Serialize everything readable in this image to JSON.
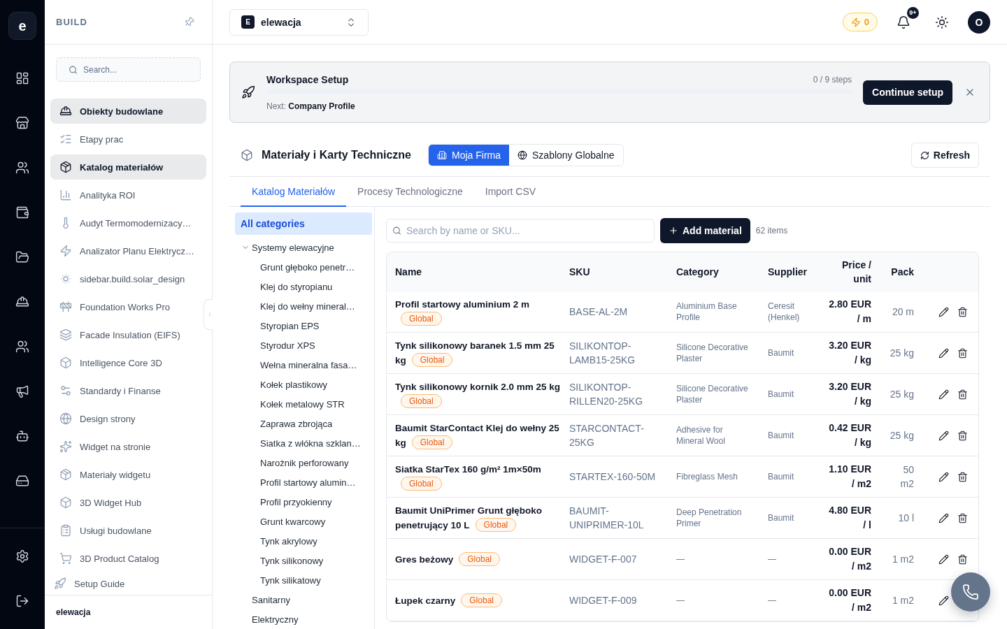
{
  "rail": {
    "logo": "e"
  },
  "sidebar": {
    "title": "BUILD",
    "search": {
      "placeholder": "Search..."
    },
    "items": [
      {
        "label": "Obiekty budowlane",
        "selected": true
      },
      {
        "label": "Etapy prac",
        "selected": false
      },
      {
        "label": "Katalog materiałów",
        "selected": true
      },
      {
        "label": "Analityka ROI",
        "selected": false
      },
      {
        "label": "Audyt Termomodernizacy…",
        "selected": false
      },
      {
        "label": "Analizator Planu Elektrycz…",
        "selected": false
      },
      {
        "label": "sidebar.build.solar_design",
        "selected": false
      },
      {
        "label": "Foundation Works Pro",
        "selected": false
      },
      {
        "label": "Facade Insulation (EIFS)",
        "selected": false
      },
      {
        "label": "Intelligence Core 3D",
        "selected": false
      },
      {
        "label": "Standardy i Finanse",
        "selected": false
      },
      {
        "label": "Design strony",
        "selected": false
      },
      {
        "label": "Widget na stronie",
        "selected": false
      },
      {
        "label": "Materiały widgetu",
        "selected": false
      },
      {
        "label": "3D Widget Hub",
        "selected": false
      },
      {
        "label": "Usługi budowlane",
        "selected": false
      },
      {
        "label": "3D Product Catalog",
        "selected": false
      }
    ],
    "setup_guide": "Setup Guide",
    "footer": "elewacja"
  },
  "topbar": {
    "workspace": {
      "initial": "E",
      "name": "elewacja"
    },
    "credits": "0",
    "notifications": "9+",
    "avatar": "O"
  },
  "setup_banner": {
    "title": "Workspace Setup",
    "steps": "0 / 9 steps",
    "progress": {
      "level": 0
    },
    "next": "Next: **Company Profile**",
    "button": "Continue setup"
  },
  "catalog_header": {
    "title": "Materiały i Karty Techniczne",
    "scopes": [
      {
        "label": "Moja Firma",
        "selected": true
      },
      {
        "label": "Szablony Globalne",
        "selected": false
      }
    ],
    "refresh": "Refresh"
  },
  "tabs": [
    {
      "label": "Katalog Materiałów",
      "selected": true
    },
    {
      "label": "Procesy Technologiczne",
      "selected": false
    },
    {
      "label": "Import CSV",
      "selected": false
    }
  ],
  "category_filter": {
    "all": {
      "label": "All categories",
      "selected": true
    },
    "tree": [
      {
        "label": "Systemy elewacyjne",
        "selected": false,
        "expanded": true,
        "children": [
          {
            "label": "Grunt głęboko penetr…",
            "selected": false
          },
          {
            "label": "Klej do styropianu",
            "selected": false
          },
          {
            "label": "Klej do wełny mineral…",
            "selected": false
          },
          {
            "label": "Styropian EPS",
            "selected": false
          },
          {
            "label": "Styrodur XPS",
            "selected": false
          },
          {
            "label": "Wełna mineralna fasa…",
            "selected": false
          },
          {
            "label": "Kołek plastikowy",
            "selected": false
          },
          {
            "label": "Kołek metalowy STR",
            "selected": false
          },
          {
            "label": "Zaprawa zbrojąca",
            "selected": false
          },
          {
            "label": "Siatka z włókna szklan…",
            "selected": false
          },
          {
            "label": "Narożnik perforowany",
            "selected": false
          },
          {
            "label": "Profil startowy alumin…",
            "selected": false
          },
          {
            "label": "Profil przyokienny",
            "selected": false
          },
          {
            "label": "Grunt kwarcowy",
            "selected": false
          },
          {
            "label": "Tynk akrylowy",
            "selected": false
          },
          {
            "label": "Tynk silikonowy",
            "selected": false
          },
          {
            "label": "Tynk silikatowy",
            "selected": false
          }
        ]
      },
      {
        "label": "Sanitarny",
        "selected": false
      },
      {
        "label": "Elektryczny",
        "selected": false
      }
    ]
  },
  "toolbar": {
    "search": {
      "placeholder": "Search by name or SKU..."
    },
    "add_button": "Add material",
    "count": "62 items"
  },
  "table": {
    "columns": [
      "Name",
      "SKU",
      "Category",
      "Supplier",
      "Price / unit",
      "Pack"
    ],
    "rows": [
      {
        "name": "Profil startowy aluminium 2 m",
        "badge": "Global",
        "sku": "BASE-AL-2M",
        "category": "Aluminium Base Profile",
        "supplier": "Ceresit (Henkel)",
        "price": "2.80 EUR / m",
        "pack": "20 m"
      },
      {
        "name": "Tynk silikonowy baranek 1.5 mm 25 kg",
        "badge": "Global",
        "sku": "SILIKONTOP-LAMB15-25KG",
        "category": "Silicone Decorative Plaster",
        "supplier": "Baumit",
        "price": "3.20 EUR / kg",
        "pack": "25 kg"
      },
      {
        "name": "Tynk silikonowy kornik 2.0 mm 25 kg",
        "badge": "Global",
        "sku": "SILIKONTOP-RILLEN20-25KG",
        "category": "Silicone Decorative Plaster",
        "supplier": "Baumit",
        "price": "3.20 EUR / kg",
        "pack": "25 kg"
      },
      {
        "name": "Baumit StarContact Klej do wełny 25 kg",
        "badge": "Global",
        "sku": "STARCONTACT-25KG",
        "category": "Adhesive for Mineral Wool",
        "supplier": "Baumit",
        "price": "0.42 EUR / kg",
        "pack": "25 kg"
      },
      {
        "name": "Siatka StarTex 160 g/m² 1m×50m",
        "badge": "Global",
        "sku": "STARTEX-160-50M",
        "category": "Fibreglass Mesh",
        "supplier": "Baumit",
        "price": "1.10 EUR / m2",
        "pack": "50 m2"
      },
      {
        "name": "Baumit UniPrimer Grunt głęboko penetrujący 10 L",
        "badge": "Global",
        "sku": "BAUMIT-UNIPRIMER-10L",
        "category": "Deep Penetration Primer",
        "supplier": "Baumit",
        "price": "4.80 EUR / l",
        "pack": "10 l"
      },
      {
        "name": "Gres beżowy",
        "badge": "Global",
        "sku": "WIDGET-F-007",
        "category": "—",
        "supplier": "—",
        "price": "0.00 EUR / m2",
        "pack": "1 m2"
      },
      {
        "name": "Łupek czarny",
        "badge": "Global",
        "sku": "WIDGET-F-009",
        "category": "—",
        "supplier": "—",
        "price": "0.00 EUR / m2",
        "pack": "1 m2"
      }
    ]
  }
}
